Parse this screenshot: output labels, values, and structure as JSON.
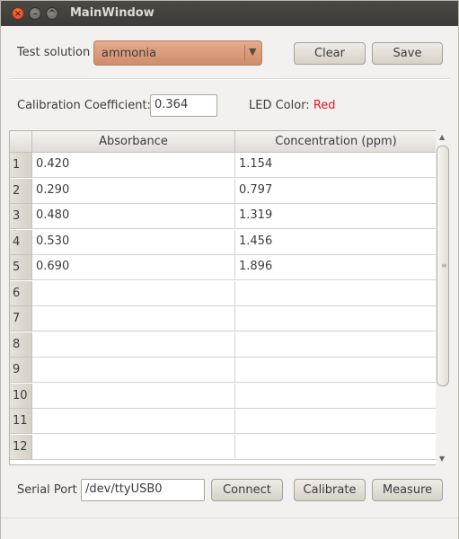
{
  "window": {
    "title": "MainWindow"
  },
  "titlebar_icons": [
    "close-icon",
    "minimize-icon",
    "maximize-icon"
  ],
  "test_solution": {
    "label": "Test solution",
    "selected": "ammonia"
  },
  "buttons": {
    "clear": "Clear",
    "save": "Save",
    "connect": "Connect",
    "calibrate": "Calibrate",
    "measure": "Measure"
  },
  "calibration": {
    "label": "Calibration Coefficient:",
    "value": "0.364"
  },
  "led": {
    "label": "LED Color:",
    "value": "Red",
    "color": "#e5191b"
  },
  "table": {
    "headers": [
      "Absorbance",
      "Concentration (ppm)"
    ],
    "rows": [
      {
        "num": "1",
        "absorbance": "0.420",
        "concentration": "1.154"
      },
      {
        "num": "2",
        "absorbance": "0.290",
        "concentration": "0.797"
      },
      {
        "num": "3",
        "absorbance": "0.480",
        "concentration": "1.319"
      },
      {
        "num": "4",
        "absorbance": "0.530",
        "concentration": "1.456"
      },
      {
        "num": "5",
        "absorbance": "0.690",
        "concentration": "1.896"
      },
      {
        "num": "6",
        "absorbance": "",
        "concentration": ""
      },
      {
        "num": "7",
        "absorbance": "",
        "concentration": ""
      },
      {
        "num": "8",
        "absorbance": "",
        "concentration": ""
      },
      {
        "num": "9",
        "absorbance": "",
        "concentration": ""
      },
      {
        "num": "10",
        "absorbance": "",
        "concentration": ""
      },
      {
        "num": "11",
        "absorbance": "",
        "concentration": ""
      },
      {
        "num": "12",
        "absorbance": "",
        "concentration": ""
      }
    ]
  },
  "serial": {
    "label": "Serial Port",
    "value": "/dev/ttyUSB0"
  }
}
